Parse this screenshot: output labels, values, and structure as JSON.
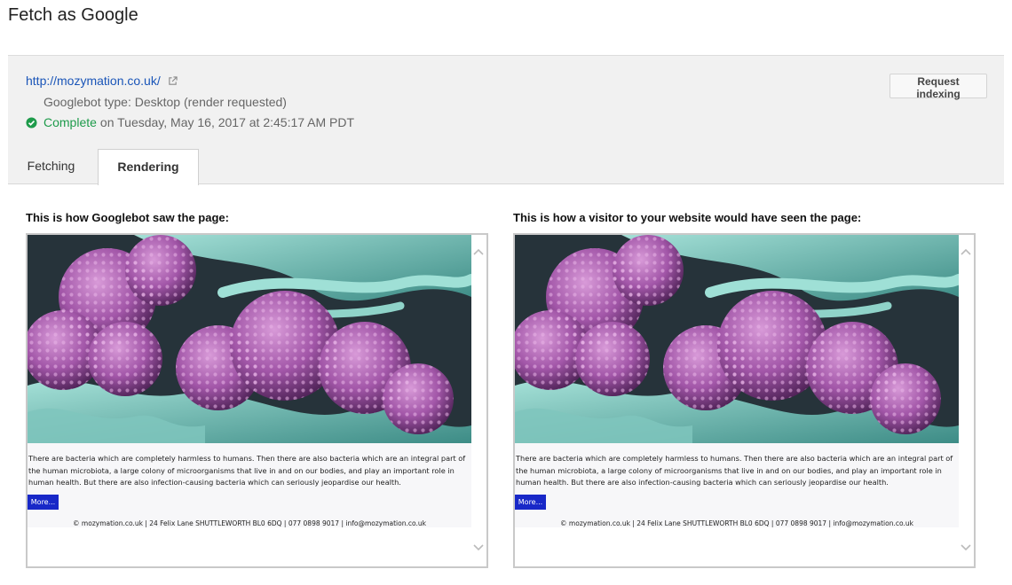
{
  "page": {
    "title": "Fetch as Google"
  },
  "fetch": {
    "url": "http://mozymation.co.uk/",
    "bot_type": "Googlebot type: Desktop (render requested)",
    "status": "Complete",
    "status_detail": "on Tuesday, May 16, 2017 at 2:45:17 AM PDT",
    "request_indexing_label": "Request indexing",
    "status_color": "#1e9b4b",
    "link_color": "#1a55b8"
  },
  "tabs": [
    {
      "label": "Fetching",
      "active": false
    },
    {
      "label": "Rendering",
      "active": true
    }
  ],
  "panels": [
    {
      "heading": "This is how Googlebot saw the page:",
      "body_text": "There are bacteria which are completely harmless to humans. Then there are also bacteria which are an integral part of the human microbiota, a large colony of microorganisms that live in and on our bodies, and play an important role in human health. But there are also infection-causing bacteria which can seriously jeopardise our health.",
      "more_label": "More...",
      "footer": "© mozymation.co.uk | 24 Felix Lane SHUTTLEWORTH BL0 6DQ | 077 0898 9017 | info@mozymation.co.uk"
    },
    {
      "heading": "This is how a visitor to your website would have seen the page:",
      "body_text": "There are bacteria which are completely harmless to humans. Then there are also bacteria which are an integral part of the human microbiota, a large colony of microorganisms that live in and on our bodies, and play an important role in human health. But there are also infection-causing bacteria which can seriously jeopardise our health.",
      "more_label": "More...",
      "footer": "© mozymation.co.uk | 24 Felix Lane SHUTTLEWORTH BL0 6DQ | 077 0898 9017 | info@mozymation.co.uk"
    }
  ],
  "icons": {
    "external_link": "external-link-icon",
    "status_check": "check-circle-icon",
    "scroll_up": "chevron-up-icon",
    "scroll_down": "chevron-down-icon"
  }
}
